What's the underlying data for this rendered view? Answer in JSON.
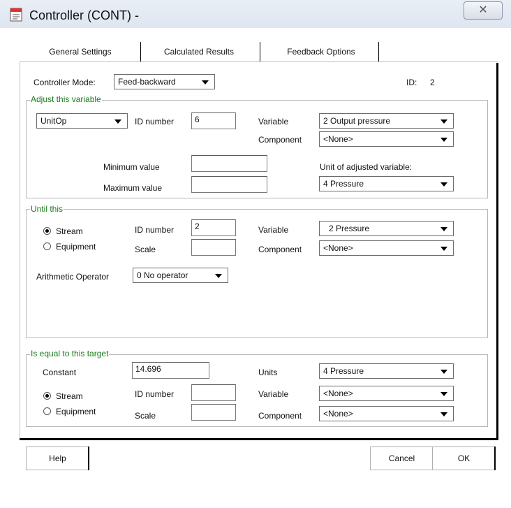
{
  "window": {
    "title": "Controller (CONT) -",
    "close_glyph": "✕"
  },
  "tabs": [
    {
      "label": "General Settings"
    },
    {
      "label": "Calculated Results"
    },
    {
      "label": "Feedback Options"
    }
  ],
  "controller_mode": {
    "label": "Controller Mode:",
    "value": "Feed-backward"
  },
  "id_display": {
    "label": "ID:",
    "value": "2"
  },
  "adjust": {
    "legend": "Adjust this variable",
    "type_select": "UnitOp",
    "id_label": "ID number",
    "id_value": "6",
    "variable_label": "Variable",
    "variable_value": "2 Output pressure",
    "component_label": "Component",
    "component_value": "<None>",
    "min_label": "Minimum  value",
    "min_value": "",
    "max_label": "Maximum  value",
    "max_value": "",
    "unit_label": "Unit of adjusted variable:",
    "unit_value": "4  Pressure"
  },
  "until": {
    "legend": "Until this",
    "stream_label": "Stream",
    "equipment_label": "Equipment",
    "selected": "Stream",
    "id_label": "ID number",
    "id_value": "2",
    "scale_label": "Scale",
    "scale_value": "",
    "variable_label": "Variable",
    "variable_value": "2 Pressure",
    "component_label": "Component",
    "component_value": "<None>",
    "arith_label": "Arithmetic Operator",
    "arith_value": "0 No operator"
  },
  "target": {
    "legend": "Is equal to this target",
    "constant_label": "Constant",
    "constant_value": "14.696",
    "units_label": "Units",
    "units_value": "4  Pressure",
    "stream_label": "Stream",
    "equipment_label": "Equipment",
    "selected": "Stream",
    "id_label": "ID number",
    "id_value": "",
    "scale_label": "Scale",
    "scale_value": "",
    "variable_label": "Variable",
    "variable_value": "<None>",
    "component_label": "Component",
    "component_value": "<None>"
  },
  "footer": {
    "help": "Help",
    "cancel": "Cancel",
    "ok": "OK"
  }
}
